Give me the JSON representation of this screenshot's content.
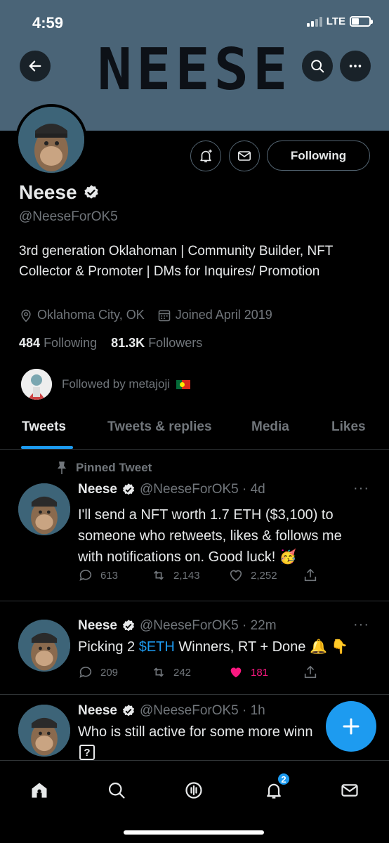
{
  "status": {
    "time": "4:59",
    "network": "LTE"
  },
  "banner": {
    "text": "NEESE"
  },
  "profile": {
    "name": "Neese",
    "handle": "@NeeseForOK5",
    "bio": "3rd generation Oklahoman | Community Builder, NFT Collector & Promoter | DMs for Inquires/ Promotion",
    "location": "Oklahoma City, OK",
    "joined": "Joined April 2019",
    "following_count": "484",
    "following_label": "Following",
    "followers_count": "81.3K",
    "followers_label": "Followers",
    "followed_by": "Followed by metajoji",
    "follow_button": "Following"
  },
  "tabs": [
    "Tweets",
    "Tweets & replies",
    "Media",
    "Likes"
  ],
  "pinned_label": "Pinned Tweet",
  "tweets": [
    {
      "name": "Neese",
      "handle": "@NeeseForOK5 · 4d",
      "text": "I'll send a NFT worth 1.7 ETH ($3,100) to someone who retweets, likes & follows me with notifications on. Good luck! 🥳",
      "replies": "613",
      "retweets": "2,143",
      "likes": "2,252"
    },
    {
      "name": "Neese",
      "handle": "@NeeseForOK5 · 22m",
      "text_before": "Picking 2 ",
      "text_tag": "$ETH",
      "text_after": " Winners, RT + Done 🔔 👇",
      "replies": "209",
      "retweets": "242",
      "likes": "181"
    },
    {
      "name": "Neese",
      "handle": "@NeeseForOK5 · 1h",
      "text": "Who is still active for some more winn",
      "glyph": "?"
    }
  ],
  "nav": {
    "notifications_badge": "2"
  },
  "colors": {
    "accent": "#1d9bf0",
    "like": "#f91880",
    "banner": "#4a6477"
  }
}
